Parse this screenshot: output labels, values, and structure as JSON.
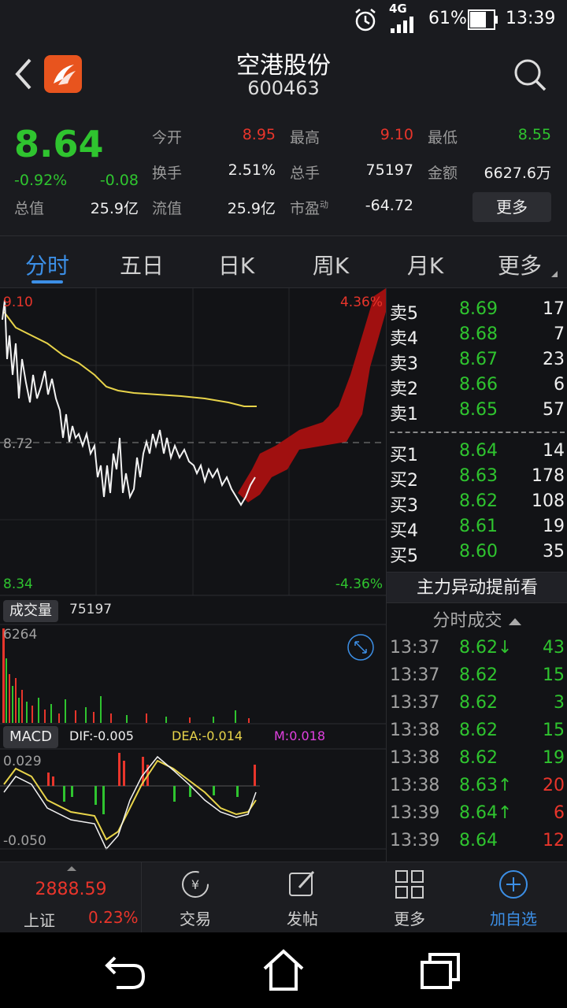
{
  "status_bar": {
    "network": "4G",
    "battery": "61%",
    "time": "13:39"
  },
  "header": {
    "title": "空港股份",
    "code": "600463"
  },
  "quote": {
    "price": "8.64",
    "change_pct": "-0.92%",
    "change": "-0.08",
    "fields": {
      "open_label": "今开",
      "open": "8.95",
      "high_label": "最高",
      "high": "9.10",
      "low_label": "最低",
      "low": "8.55",
      "turnover_label": "换手",
      "turnover": "2.51%",
      "volume_label": "总手",
      "volume": "75197",
      "amount_label": "金额",
      "amount": "6627.6万",
      "total_cap_label": "总值",
      "total_cap": "25.9亿",
      "float_cap_label": "流值",
      "float_cap": "25.9亿",
      "pe_label": "市盈",
      "pe_sup": "动",
      "pe": "-64.72"
    },
    "more_button": "更多"
  },
  "tabs": [
    "分时",
    "五日",
    "日K",
    "周K",
    "月K",
    "更多"
  ],
  "chart": {
    "price_high_label": "9.10",
    "price_mid_label": "8.72",
    "price_low_label": "8.34",
    "pct_high_label": "4.36%",
    "pct_low_label": "-4.36%",
    "volume_tag": "成交量",
    "volume_value": "75197",
    "volume_max": "6264",
    "macd_tag": "MACD",
    "dif": "DIF:-0.005",
    "dea": "DEA:-0.014",
    "m": "M:0.018",
    "macd_high": "0.029",
    "macd_low": "-0.050"
  },
  "order_book": {
    "asks": [
      {
        "label": "卖5",
        "price": "8.69",
        "qty": "17"
      },
      {
        "label": "卖4",
        "price": "8.68",
        "qty": "7"
      },
      {
        "label": "卖3",
        "price": "8.67",
        "qty": "23"
      },
      {
        "label": "卖2",
        "price": "8.66",
        "qty": "6"
      },
      {
        "label": "卖1",
        "price": "8.65",
        "qty": "57"
      }
    ],
    "bids": [
      {
        "label": "买1",
        "price": "8.64",
        "qty": "14"
      },
      {
        "label": "买2",
        "price": "8.63",
        "qty": "178"
      },
      {
        "label": "买3",
        "price": "8.62",
        "qty": "108"
      },
      {
        "label": "买4",
        "price": "8.61",
        "qty": "19"
      },
      {
        "label": "买5",
        "price": "8.60",
        "qty": "35"
      }
    ],
    "banner": "主力异动提前看",
    "ticks_header": "分时成交",
    "ticks": [
      {
        "time": "13:37",
        "price": "8.62↓",
        "qty": "43",
        "qty_color": "green"
      },
      {
        "time": "13:37",
        "price": "8.62",
        "qty": "15",
        "qty_color": "green"
      },
      {
        "time": "13:37",
        "price": "8.62",
        "qty": "3",
        "qty_color": "green"
      },
      {
        "time": "13:38",
        "price": "8.62",
        "qty": "15",
        "qty_color": "green"
      },
      {
        "time": "13:38",
        "price": "8.62",
        "qty": "19",
        "qty_color": "green"
      },
      {
        "time": "13:38",
        "price": "8.63↑",
        "qty": "20",
        "qty_color": "red"
      },
      {
        "time": "13:39",
        "price": "8.64↑",
        "qty": "6",
        "qty_color": "red"
      },
      {
        "time": "13:39",
        "price": "8.64",
        "qty": "12",
        "qty_color": "red"
      }
    ]
  },
  "bottom_nav": {
    "index_value": "2888.59",
    "index_name": "上证",
    "index_change": "0.23%",
    "items": [
      "交易",
      "发帖",
      "更多",
      "加自选"
    ]
  }
}
